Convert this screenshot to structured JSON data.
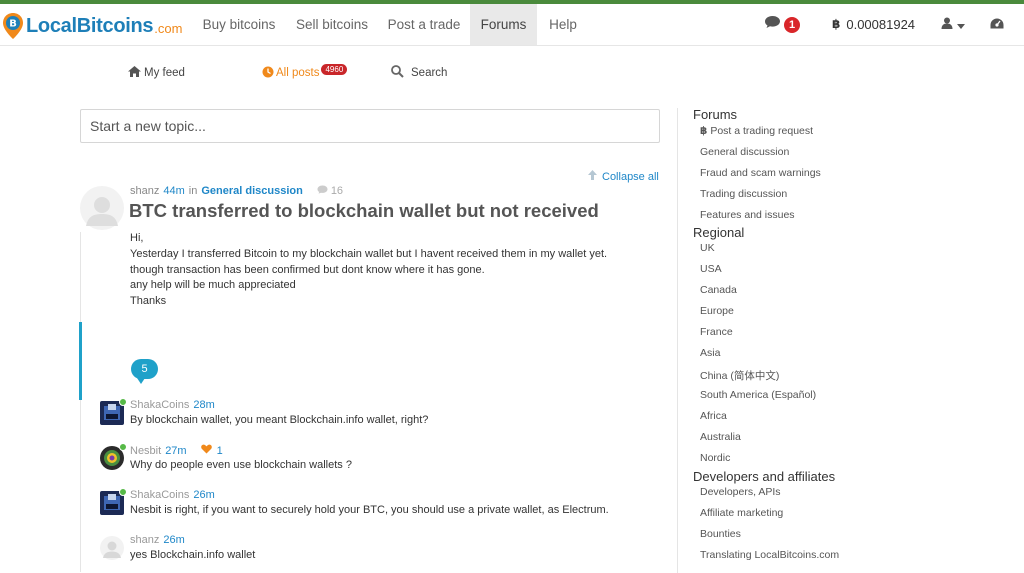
{
  "header": {
    "logo_text": "LocalBitcoins",
    "logo_suffix": ".com",
    "nav": [
      {
        "label": "Buy bitcoins"
      },
      {
        "label": "Sell bitcoins"
      },
      {
        "label": "Post a trade"
      },
      {
        "label": "Forums"
      },
      {
        "label": "Help"
      }
    ],
    "active_nav": "Forums",
    "messages_count": "1",
    "balance": "0.00081924",
    "accent_color": "#1e7fb8",
    "brand_orange": "#f0891b"
  },
  "subnav": {
    "my_feed": "My feed",
    "all_posts": "All posts",
    "all_posts_count": "4960",
    "search": "Search"
  },
  "composer": {
    "placeholder": "Start a new topic..."
  },
  "collapse_all": "Collapse all",
  "post": {
    "author": "shanz",
    "time": "44m",
    "in_text": "in",
    "category": "General discussion",
    "comment_count": "16",
    "title": "BTC transferred to blockchain wallet but not received",
    "body_lines": [
      "Hi,",
      "Yesterday I transferred Bitcoin to my blockchain wallet but I havent received them in my wallet yet.",
      "though transaction has been confirmed but dont know where it has gone.",
      "any help will be much appreciated",
      "Thanks"
    ],
    "reply_count": "5"
  },
  "comments": [
    {
      "author": "ShakaCoins",
      "time": "28m",
      "likes": "",
      "text": "By blockchain wallet, you meant Blockchain.info wallet, right?"
    },
    {
      "author": "Nesbit",
      "time": "27m",
      "likes": "1",
      "text": "Why do people even use blockchain wallets ?"
    },
    {
      "author": "ShakaCoins",
      "time": "26m",
      "likes": "",
      "text": "Nesbit is right, if you want to securely hold your BTC, you should use a private wallet, as Electrum."
    },
    {
      "author": "shanz",
      "time": "26m",
      "likes": "",
      "text": "yes Blockchain.info wallet"
    }
  ],
  "sidebar": {
    "forums_heading": "Forums",
    "forums": [
      "Post a trading request",
      "General discussion",
      "Fraud and scam warnings",
      "Trading discussion",
      "Features and issues"
    ],
    "regional_heading": "Regional",
    "regional": [
      "UK",
      "USA",
      "Canada",
      "Europe",
      "France",
      "Asia",
      "China (简体中文)",
      "South America (Español)",
      "Africa",
      "Australia",
      "Nordic"
    ],
    "dev_heading": "Developers and affiliates",
    "dev": [
      "Developers, APIs",
      "Affiliate marketing",
      "Bounties",
      "Translating LocalBitcoins.com"
    ]
  }
}
